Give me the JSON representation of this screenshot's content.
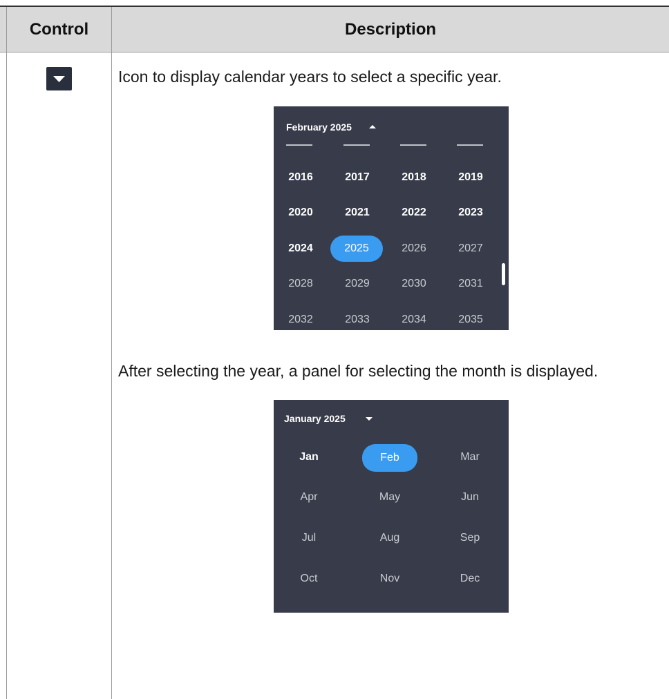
{
  "table": {
    "headers": {
      "control": "Control",
      "description": "Description"
    }
  },
  "row": {
    "control_icon": "dropdown-arrow-icon",
    "description_line1": "Icon to display calendar years to select a specific year.",
    "description_line2": "After selecting the year, a panel for selecting the month is displayed."
  },
  "year_picker": {
    "title": "February 2025",
    "caret": "caret-up-icon",
    "years": [
      [
        "2016",
        "2017",
        "2018",
        "2019"
      ],
      [
        "2020",
        "2021",
        "2022",
        "2023"
      ],
      [
        "2024",
        "2025",
        "2026",
        "2027"
      ],
      [
        "2028",
        "2029",
        "2030",
        "2031"
      ],
      [
        "2032",
        "2033",
        "2034",
        "2035"
      ]
    ],
    "selected_year": "2025"
  },
  "month_picker": {
    "title": "January 2025",
    "caret": "caret-down-icon",
    "months": [
      [
        "Jan",
        "Feb",
        "Mar"
      ],
      [
        "Apr",
        "May",
        "Jun"
      ],
      [
        "Jul",
        "Aug",
        "Sep"
      ],
      [
        "Oct",
        "Nov",
        "Dec"
      ]
    ],
    "selected_month": "Feb"
  },
  "colors": {
    "panel_bg": "#383c4a",
    "selection": "#3a9cf0",
    "header_bg": "#d9d9d9",
    "icon_bg": "#2a2f3e"
  }
}
